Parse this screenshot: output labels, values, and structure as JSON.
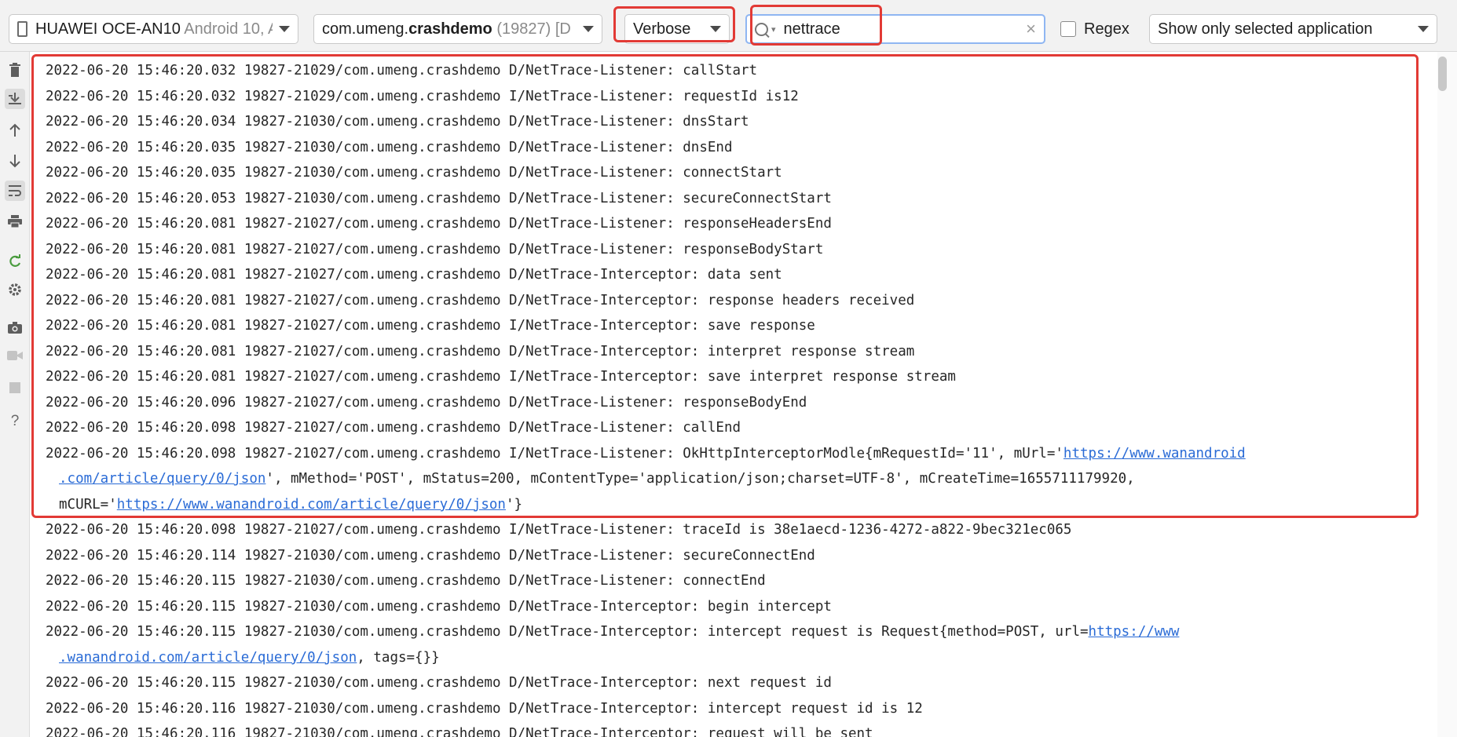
{
  "toolbar": {
    "device": {
      "name": "HUAWEI OCE-AN10",
      "detail": "Android 10, A"
    },
    "process": {
      "prefix": "com.umeng.",
      "bold": "crashdemo",
      "detail": "(19827) [D"
    },
    "log_level": "Verbose",
    "search": {
      "value": "nettrace"
    },
    "regex_label": "Regex",
    "regex_checked": false,
    "filter_option": "Show only selected application"
  },
  "gutter_icons": [
    "trash-icon",
    "scroll-to-end-icon",
    "arrow-up-icon",
    "arrow-down-icon",
    "soft-wrap-icon",
    "print-icon",
    "restart-icon",
    "gear-icon",
    "camera-icon",
    "video-icon",
    "stop-icon",
    "help-icon"
  ],
  "log": [
    {
      "text": "2022-06-20 15:46:20.032 19827-21029/com.umeng.crashdemo D/NetTrace-Listener: callStart"
    },
    {
      "text": "2022-06-20 15:46:20.032 19827-21029/com.umeng.crashdemo I/NetTrace-Listener: requestId is12"
    },
    {
      "text": "2022-06-20 15:46:20.034 19827-21030/com.umeng.crashdemo D/NetTrace-Listener: dnsStart"
    },
    {
      "text": "2022-06-20 15:46:20.035 19827-21030/com.umeng.crashdemo D/NetTrace-Listener: dnsEnd"
    },
    {
      "text": "2022-06-20 15:46:20.035 19827-21030/com.umeng.crashdemo D/NetTrace-Listener: connectStart"
    },
    {
      "text": "2022-06-20 15:46:20.053 19827-21030/com.umeng.crashdemo D/NetTrace-Listener: secureConnectStart"
    },
    {
      "text": "2022-06-20 15:46:20.081 19827-21027/com.umeng.crashdemo D/NetTrace-Listener: responseHeadersEnd"
    },
    {
      "text": "2022-06-20 15:46:20.081 19827-21027/com.umeng.crashdemo D/NetTrace-Listener: responseBodyStart"
    },
    {
      "text": "2022-06-20 15:46:20.081 19827-21027/com.umeng.crashdemo D/NetTrace-Interceptor: data sent"
    },
    {
      "text": "2022-06-20 15:46:20.081 19827-21027/com.umeng.crashdemo D/NetTrace-Interceptor: response headers received"
    },
    {
      "text": "2022-06-20 15:46:20.081 19827-21027/com.umeng.crashdemo I/NetTrace-Interceptor: save response"
    },
    {
      "text": "2022-06-20 15:46:20.081 19827-21027/com.umeng.crashdemo D/NetTrace-Interceptor: interpret response stream"
    },
    {
      "text": "2022-06-20 15:46:20.081 19827-21027/com.umeng.crashdemo I/NetTrace-Interceptor: save interpret response stream"
    },
    {
      "text": "2022-06-20 15:46:20.096 19827-21027/com.umeng.crashdemo D/NetTrace-Listener: responseBodyEnd"
    },
    {
      "text": "2022-06-20 15:46:20.098 19827-21027/com.umeng.crashdemo D/NetTrace-Listener: callEnd"
    },
    {
      "text": "2022-06-20 15:46:20.098 19827-21027/com.umeng.crashdemo I/NetTrace-Listener: OkHttpInterceptorModle{mRequestId='11', mUrl='",
      "link": "https://www.wanandroid"
    },
    {
      "cont": true,
      "link": ".com/article/query/0/json",
      "after": "', mMethod='POST', mStatus=200, mContentType='application/json;charset=UTF-8', mCreateTime=1655711179920,"
    },
    {
      "cont": true,
      "text": "mCURL='",
      "link": "https://www.wanandroid.com/article/query/0/json",
      "after": "'}"
    },
    {
      "text": "2022-06-20 15:46:20.098 19827-21027/com.umeng.crashdemo I/NetTrace-Listener: traceId is 38e1aecd-1236-4272-a822-9bec321ec065"
    },
    {
      "text": "2022-06-20 15:46:20.114 19827-21030/com.umeng.crashdemo D/NetTrace-Listener: secureConnectEnd"
    },
    {
      "text": "2022-06-20 15:46:20.115 19827-21030/com.umeng.crashdemo D/NetTrace-Listener: connectEnd"
    },
    {
      "text": "2022-06-20 15:46:20.115 19827-21030/com.umeng.crashdemo D/NetTrace-Interceptor: begin intercept"
    },
    {
      "text": "2022-06-20 15:46:20.115 19827-21030/com.umeng.crashdemo D/NetTrace-Interceptor: intercept request is Request{method=POST, url=",
      "link": "https://www"
    },
    {
      "cont": true,
      "link": ".wanandroid.com/article/query/0/json",
      "after": ", tags={}}"
    },
    {
      "text": "2022-06-20 15:46:20.115 19827-21030/com.umeng.crashdemo D/NetTrace-Interceptor: next request id"
    },
    {
      "text": "2022-06-20 15:46:20.116 19827-21030/com.umeng.crashdemo D/NetTrace-Interceptor: intercept request id is 12"
    },
    {
      "text": "2022-06-20 15:46:20.116 19827-21030/com.umeng.crashdemo D/NetTrace-Interceptor: request will be sent"
    }
  ]
}
